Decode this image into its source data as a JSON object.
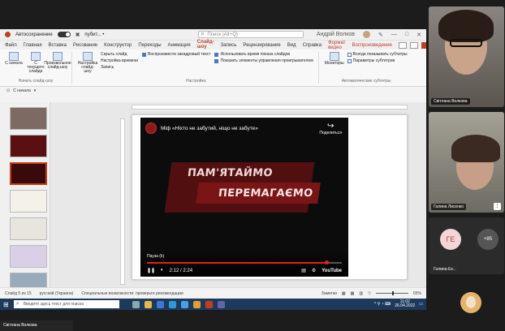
{
  "titlebar": {
    "autosave_label": "Автосохранение",
    "file_name": "пубит... •",
    "search_placeholder": "Поиск (Alt+Q)",
    "user_name": "Андрій Волков"
  },
  "menu": [
    "Файл",
    "Главная",
    "Вставка",
    "Рисование",
    "Конструктор",
    "Переходы",
    "Анимация",
    "Слайд-шоу",
    "Запись",
    "Рецензирование",
    "Вид",
    "Справка",
    "Формат видео",
    "Воспроизведение"
  ],
  "menu_active": "Слайд-шоу",
  "ribbon": {
    "buttons": [
      {
        "label": "С начала"
      },
      {
        "label": "С текущего слайда"
      },
      {
        "label": "Произвольное слайд-шоу"
      },
      {
        "label": "Настройка слайд-шоу"
      }
    ],
    "small": [
      "Скрыть слайд",
      "Настройка времени",
      "Запись"
    ],
    "group1_label": "Начать слайд-шоу",
    "group2_label": "Настройка",
    "checks": [
      {
        "label": "Воспроизвести закадровый текст",
        "on": true
      },
      {
        "label": "Использовать время показа слайдов",
        "on": true
      },
      {
        "label": "Показать элементы управления проигрывателем",
        "on": true
      }
    ],
    "monitor_label": "Мониторы",
    "monitor_checks": [
      "Всегда показывать субтитры",
      "Параметры субтитров"
    ],
    "group3_label": "Автоматические субтитры"
  },
  "sub": {
    "label": "С начала"
  },
  "thumbs": [
    "",
    "",
    "",
    "",
    "",
    "",
    ""
  ],
  "video": {
    "title": "Міф «Ніхто не забутий, ніщо не забуте»",
    "share": "Поделиться",
    "line1": "ПАМ'ЯТАЙМО",
    "line2": "ПЕРЕМАГАЄМО",
    "chapter": "Пауза (k)",
    "time": "2:12 / 2:24",
    "brand": "YouTube",
    "progress": 0.92
  },
  "status": {
    "left": "Слайд 5 из 15",
    "lang": "русский (Украина)",
    "access": "Специальные возможности: проверьте рекомендации",
    "notes": "Заметки",
    "zoom": "65%"
  },
  "taskbar": {
    "search": "Введите здесь текст для поиска",
    "time": "11:02",
    "date": "26.04.2022"
  },
  "participants": [
    {
      "name": "Світлана Волкова"
    },
    {
      "name": "Галина Лисенко"
    },
    {
      "name": "Галина-Ек...",
      "initials": "ГЕ",
      "extra": "+85"
    }
  ],
  "bottom_name": "Світлана Волкова"
}
